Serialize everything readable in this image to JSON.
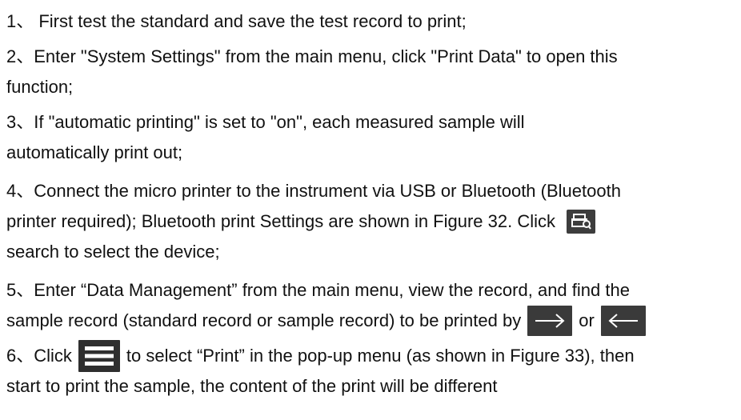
{
  "document": {
    "items": [
      {
        "lines": [
          "1、 First test the standard and save the test record to print;"
        ]
      },
      {
        "lines": [
          "2、Enter \"System Settings\" from the main menu, click \"Print Data\" to open this",
          "function;"
        ]
      },
      {
        "lines": [
          "3、If \"automatic printing\" is set to \"on\", each measured sample will",
          "automatically print out;"
        ]
      },
      {
        "lines": [
          "4、Connect the micro printer to the instrument via USB or Bluetooth (Bluetooth",
          "printer required); Bluetooth print Settings are shown in Figure 32. Click",
          "search to select the device;"
        ]
      },
      {
        "lines": [
          "5、Enter “Data Management” from the main menu, view the record, and find the",
          "sample record (standard record or sample record) to be printed by",
          "or"
        ]
      },
      {
        "lines": [
          "6、Click",
          "to select “Print” in the pop-up menu (as shown in Figure 33), then",
          "start to print the sample, the content of the print will be different"
        ]
      }
    ]
  },
  "icons": {
    "search": "search-printer-icon",
    "next": "arrow-right-icon",
    "prev": "arrow-left-icon",
    "menu": "menu-icon"
  },
  "colors": {
    "icon_bg": "#3a3a3a",
    "icon_fg": "#ffffff",
    "text": "#111111"
  }
}
